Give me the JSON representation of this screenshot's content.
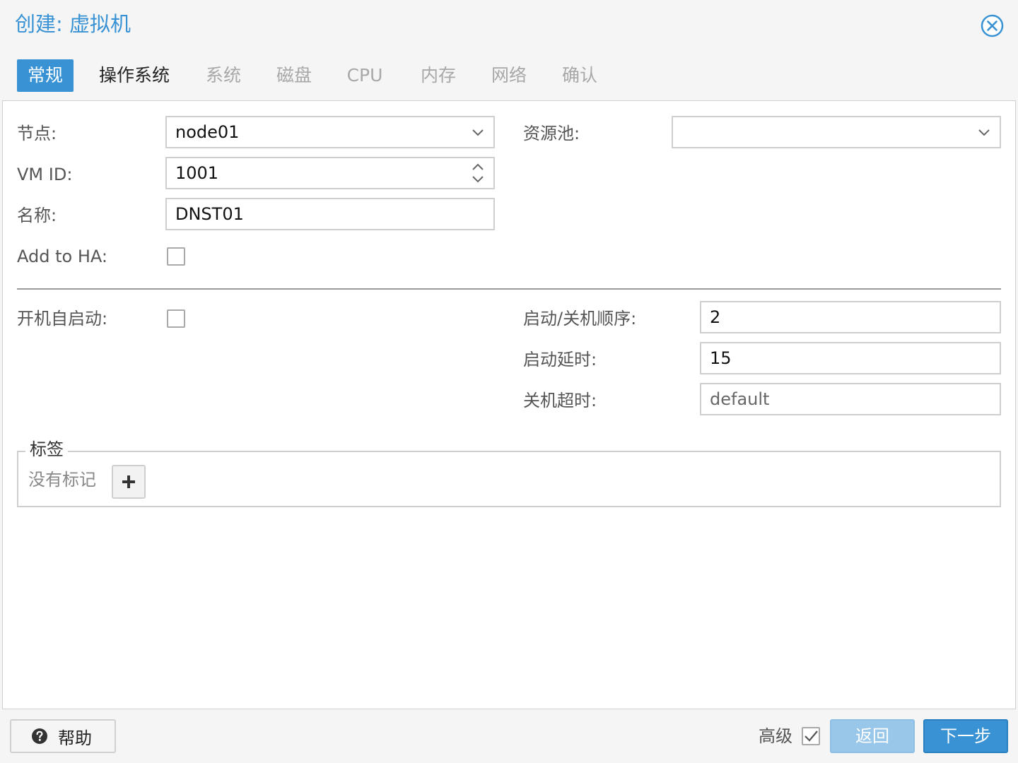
{
  "window": {
    "title": "创建: 虚拟机",
    "close_icon": "close-circle-icon"
  },
  "tabs": [
    {
      "label": "常规",
      "state": "active"
    },
    {
      "label": "操作系统",
      "state": "enabled"
    },
    {
      "label": "系统",
      "state": "disabled"
    },
    {
      "label": "磁盘",
      "state": "disabled"
    },
    {
      "label": "CPU",
      "state": "disabled"
    },
    {
      "label": "内存",
      "state": "disabled"
    },
    {
      "label": "网络",
      "state": "disabled"
    },
    {
      "label": "确认",
      "state": "disabled"
    }
  ],
  "general": {
    "node": {
      "label": "节点:",
      "value": "node01"
    },
    "pool": {
      "label": "资源池:",
      "value": ""
    },
    "vmid": {
      "label": "VM ID:",
      "value": "1001"
    },
    "name": {
      "label": "名称:",
      "value": "DNST01"
    },
    "ha": {
      "label": "Add to HA:",
      "checked": false
    },
    "onboot": {
      "label": "开机自启动:",
      "checked": false
    },
    "startup_order": {
      "label": "启动/关机顺序:",
      "value": "2"
    },
    "startup_delay": {
      "label": "启动延时:",
      "value": "15"
    },
    "shutdown_timeout": {
      "label": "关机超时:",
      "placeholder": "default"
    }
  },
  "tags": {
    "legend": "标签",
    "empty_text": "没有标记",
    "add_icon": "plus-icon"
  },
  "footer": {
    "help_label": "帮助",
    "help_icon": "question-circle-icon",
    "advanced_label": "高级",
    "advanced_checked": true,
    "back_label": "返回",
    "next_label": "下一步"
  },
  "colors": {
    "accent": "#3892d4",
    "disabled_button": "#98c7e9"
  }
}
